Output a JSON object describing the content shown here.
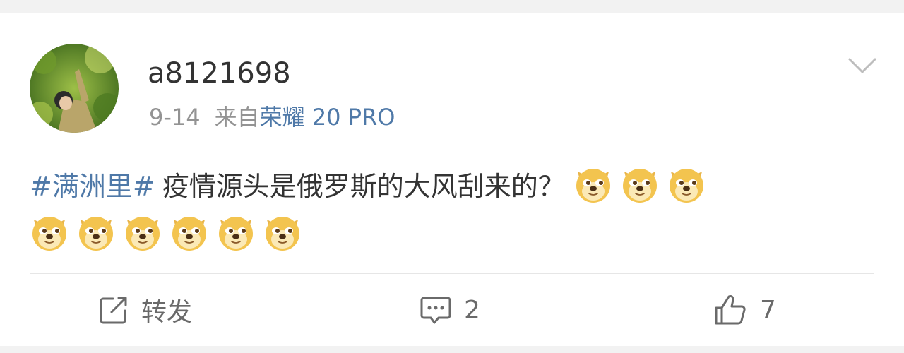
{
  "post": {
    "username": "a8121698",
    "date": "9-14",
    "source_prefix": "来自",
    "source_device": "荣耀 20 PRO",
    "hashtag": "#满洲里#",
    "text": "疫情源头是俄罗斯的大风刮来的？",
    "emoji_icon": "doge-emoji",
    "emoji_count_line1": 3,
    "emoji_count_line2": 6
  },
  "actions": {
    "repost_label": "转发",
    "comment_count": "2",
    "like_count": "7"
  },
  "colors": {
    "link": "#4f79a8",
    "meta": "#939393",
    "text": "#333333",
    "background": "#f2f2f2"
  }
}
